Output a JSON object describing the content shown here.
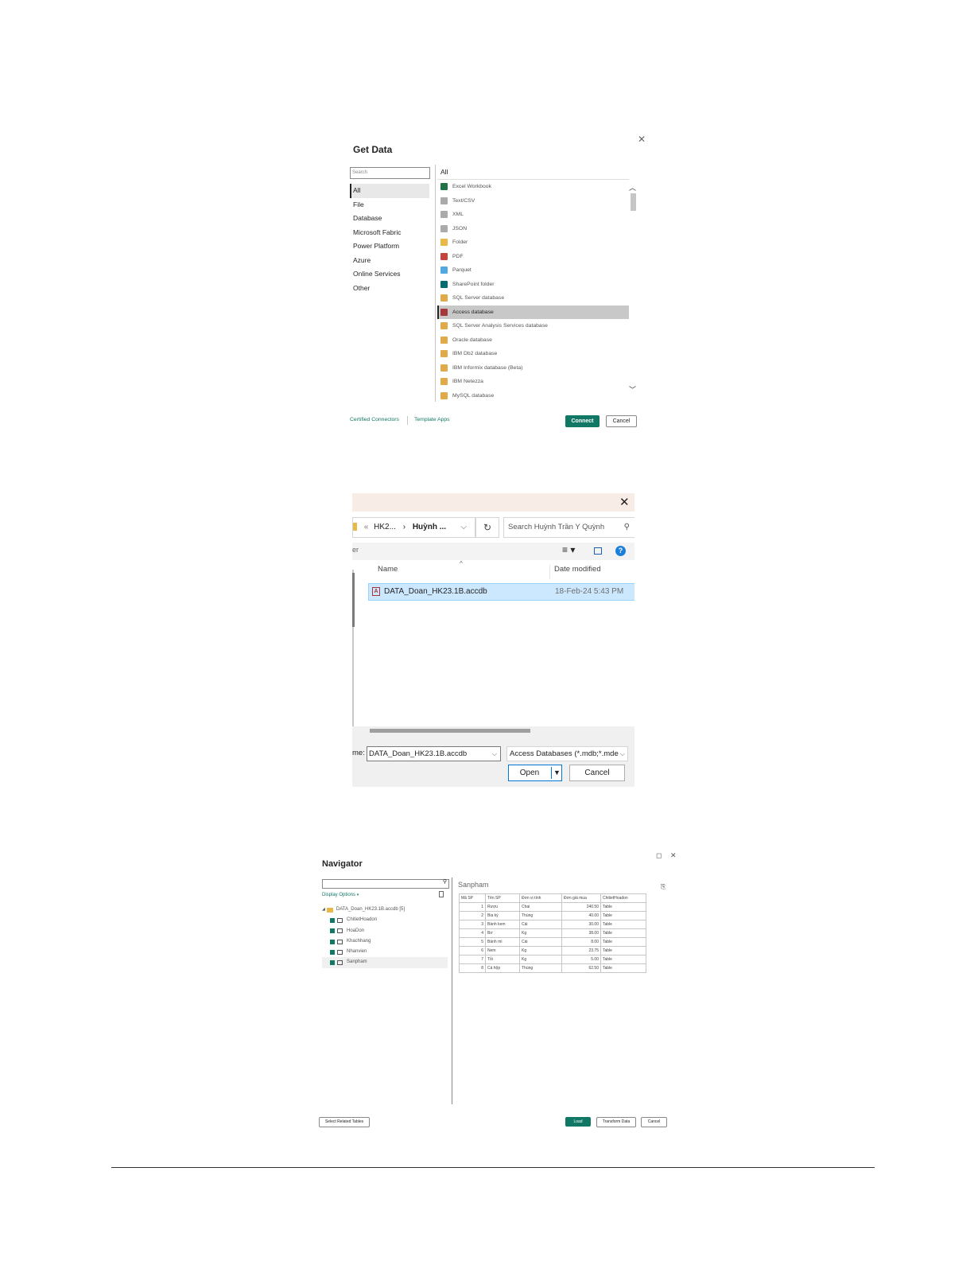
{
  "get_data": {
    "title": "Get Data",
    "search_placeholder": "Search",
    "categories": [
      "All",
      "File",
      "Database",
      "Microsoft Fabric",
      "Power Platform",
      "Azure",
      "Online Services",
      "Other"
    ],
    "selected_category": "All",
    "list_header": "All",
    "items": [
      {
        "label": "Excel Workbook",
        "icon": "excel-icon",
        "color": "#217346"
      },
      {
        "label": "Text/CSV",
        "icon": "text-file-icon",
        "color": "#aaaaaa"
      },
      {
        "label": "XML",
        "icon": "xml-file-icon",
        "color": "#aaaaaa"
      },
      {
        "label": "JSON",
        "icon": "json-file-icon",
        "color": "#aaaaaa"
      },
      {
        "label": "Folder",
        "icon": "folder-icon",
        "color": "#e8b849"
      },
      {
        "label": "PDF",
        "icon": "pdf-icon",
        "color": "#c4453c"
      },
      {
        "label": "Parquet",
        "icon": "parquet-icon",
        "color": "#52a8e0"
      },
      {
        "label": "SharePoint folder",
        "icon": "sharepoint-icon",
        "color": "#036c70"
      },
      {
        "label": "SQL Server database",
        "icon": "database-icon",
        "color": "#e0a94a"
      },
      {
        "label": "Access database",
        "icon": "access-icon",
        "color": "#a4373a",
        "selected": true
      },
      {
        "label": "SQL Server Analysis Services database",
        "icon": "cube-icon",
        "color": "#e0a94a"
      },
      {
        "label": "Oracle database",
        "icon": "database-icon",
        "color": "#e0a94a"
      },
      {
        "label": "IBM Db2 database",
        "icon": "database-icon",
        "color": "#e0a94a"
      },
      {
        "label": "IBM Informix database (Beta)",
        "icon": "database-icon",
        "color": "#e0a94a"
      },
      {
        "label": "IBM Netezza",
        "icon": "database-icon",
        "color": "#e0a94a"
      },
      {
        "label": "MySQL database",
        "icon": "database-icon",
        "color": "#e0a94a"
      }
    ],
    "certified_connectors": "Certified Connectors",
    "template_apps": "Template Apps",
    "connect": "Connect",
    "cancel": "Cancel",
    "accent": "#117865"
  },
  "file_dialog": {
    "breadcrumb_1": "HK2...",
    "breadcrumb_2": "Huỳnh ...",
    "search_placeholder": "Search Huỳnh Trần Y Quỳnh",
    "col_name": "Name",
    "col_date": "Date modified",
    "file_name": "DATA_Doan_HK23.1B.accdb",
    "file_date": "18-Feb-24 5:43 PM",
    "filename_label": "me:",
    "filename_value": "DATA_Doan_HK23.1B.accdb",
    "filetype": "Access Databases (*.mdb;*.mde",
    "open": "Open",
    "cancel": "Cancel",
    "left_stub": "er"
  },
  "navigator": {
    "title": "Navigator",
    "display_options": "Display Options",
    "root": "DATA_Doan_HK23.1B.accdb [5]",
    "tables": [
      {
        "label": "ChitietHoadon",
        "selected": false
      },
      {
        "label": "HoaDon",
        "selected": false
      },
      {
        "label": "Khachhang",
        "selected": false
      },
      {
        "label": "Nhanvien",
        "selected": false
      },
      {
        "label": "Sanpham",
        "selected": true
      }
    ],
    "preview_title": "Sanpham",
    "columns": [
      "Mã SP",
      "Tên SP",
      "Đơn vị tính",
      "Đơn giá mua",
      "ChitietHoadon"
    ],
    "rows": [
      [
        "1",
        "Rượu",
        "Chai",
        "240.50",
        "Table"
      ],
      [
        "2",
        "Bia ký",
        "Thùng",
        "40.00",
        "Table"
      ],
      [
        "3",
        "Bánh kem",
        "Cái",
        "30.00",
        "Table"
      ],
      [
        "4",
        "Bơ",
        "Kg",
        "38.00",
        "Table"
      ],
      [
        "5",
        "Bánh mì",
        "Cái",
        "8.00",
        "Table"
      ],
      [
        "6",
        "Nem",
        "Kg",
        "23.75",
        "Table"
      ],
      [
        "7",
        "Tỏi",
        "Kg",
        "5.00",
        "Table"
      ],
      [
        "8",
        "Cá hộp",
        "Thùng",
        "62.50",
        "Table"
      ]
    ],
    "select_related": "Select Related Tables",
    "load": "Load",
    "transform": "Transform Data",
    "cancel": "Cancel"
  }
}
